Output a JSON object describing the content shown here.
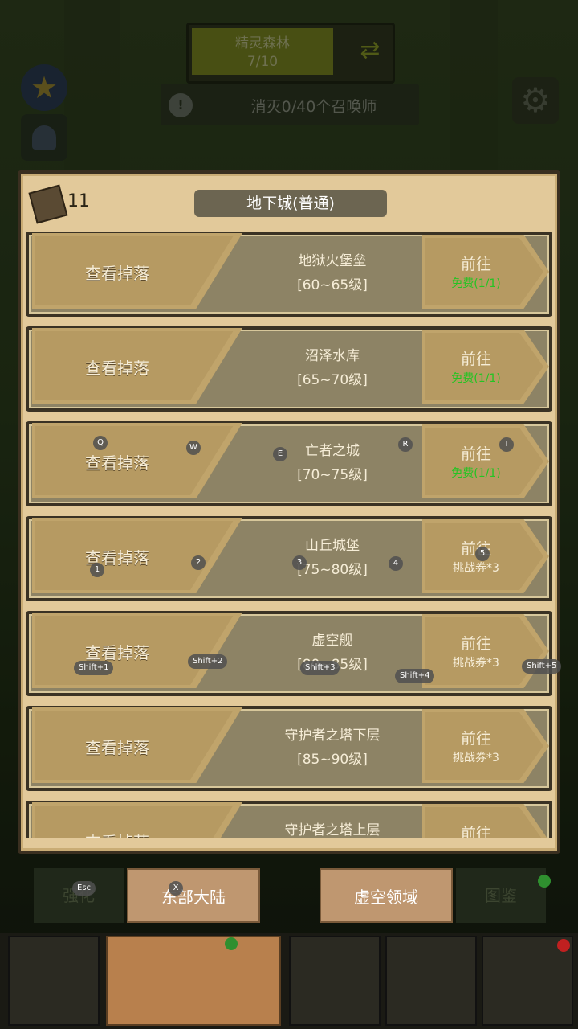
{
  "hud": {
    "stage_name": "精灵森林",
    "stage_progress": "7/10",
    "quest_text": "消灭0/40个召唤师"
  },
  "panel": {
    "key_count": "11",
    "title": "地下城(普通)"
  },
  "dungeons": [
    {
      "drop": "查看掉落",
      "name": "地狱火堡垒",
      "range": "[60~65级]",
      "go": "前往",
      "cost": "免费(1/1)",
      "free": true
    },
    {
      "drop": "查看掉落",
      "name": "沼泽水库",
      "range": "[65~70级]",
      "go": "前往",
      "cost": "免费(1/1)",
      "free": true
    },
    {
      "drop": "查看掉落",
      "name": "亡者之城",
      "range": "[70~75级]",
      "go": "前往",
      "cost": "免费(1/1)",
      "free": true
    },
    {
      "drop": "查看掉落",
      "name": "山丘城堡",
      "range": "[75~80级]",
      "go": "前往",
      "cost": "挑战券*3",
      "free": false
    },
    {
      "drop": "查看掉落",
      "name": "虚空舰",
      "range": "[80~85级]",
      "go": "前往",
      "cost": "挑战券*3",
      "free": false
    },
    {
      "drop": "查看掉落",
      "name": "守护者之塔下层",
      "range": "[85~90级]",
      "go": "前往",
      "cost": "挑战券*3",
      "free": false
    },
    {
      "drop": "查看掉落",
      "name": "守护者之塔上层",
      "range": "",
      "go": "前往",
      "cost": "",
      "free": false
    }
  ],
  "hints": {
    "q": "Q",
    "w": "W",
    "e": "E",
    "r": "R",
    "t": "T",
    "k1": "1",
    "k2": "2",
    "k3": "3",
    "k4": "4",
    "k5": "5",
    "s1": "Shift+1",
    "s2": "Shift+2",
    "s3": "Shift+3",
    "s4": "Shift+4",
    "s5": "Shift+5",
    "esc": "Esc",
    "x": "X"
  },
  "tabs": {
    "strengthen": "强化",
    "continent": "东部大陆",
    "void": "虚空领域",
    "codex": "图鉴"
  }
}
